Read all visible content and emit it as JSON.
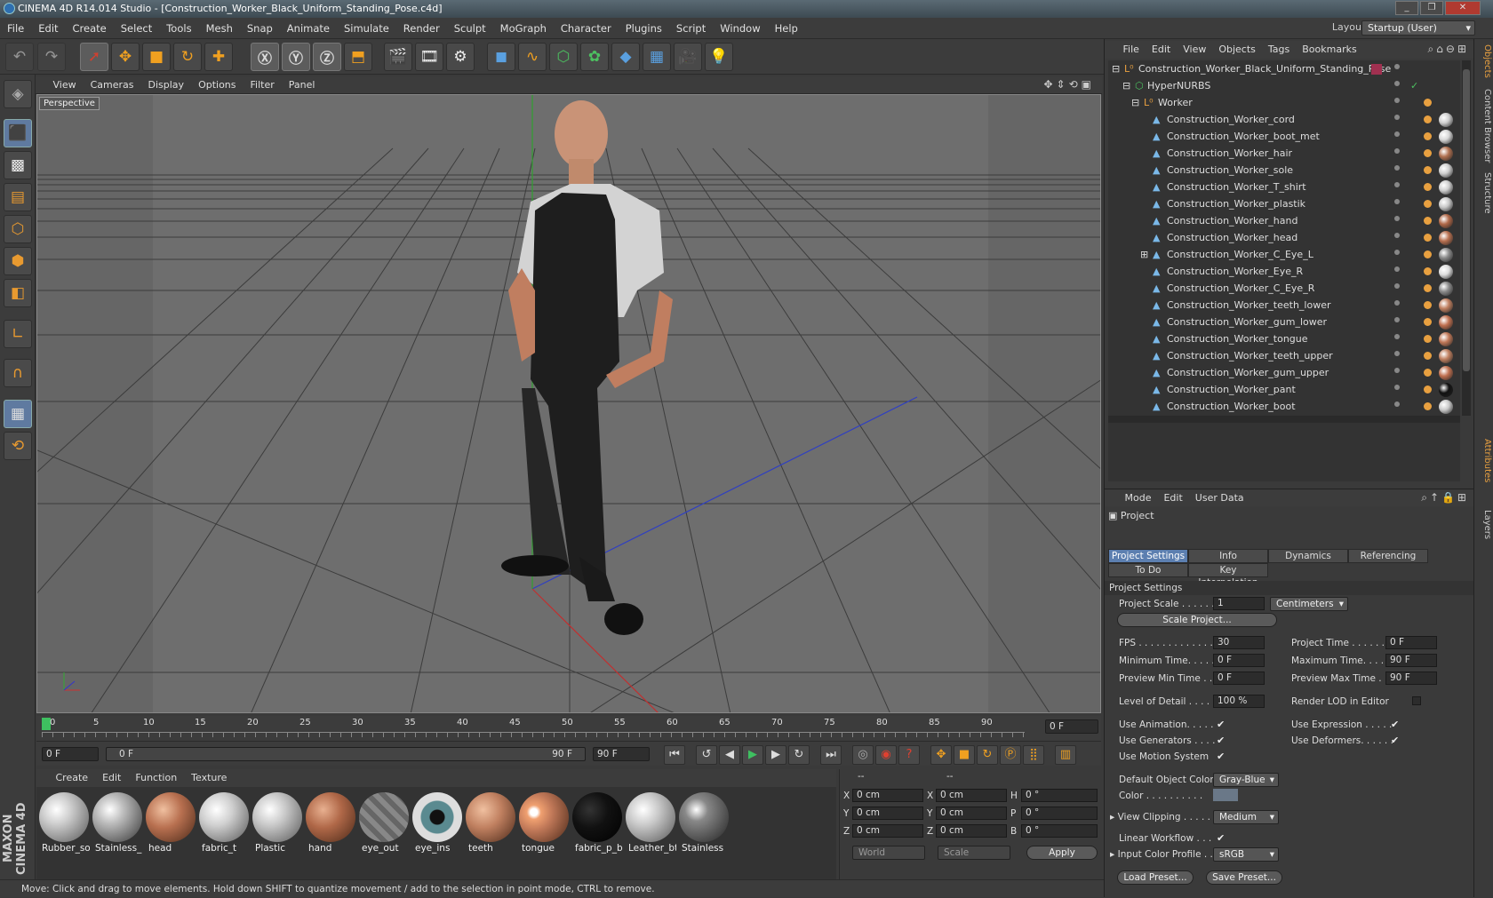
{
  "window": {
    "title": "CINEMA 4D R14.014 Studio - [Construction_Worker_Black_Uniform_Standing_Pose.c4d]",
    "layout_label": "Layout:",
    "layout_value": "Startup (User)"
  },
  "menu": [
    "File",
    "Edit",
    "Create",
    "Select",
    "Tools",
    "Mesh",
    "Snap",
    "Animate",
    "Simulate",
    "Render",
    "Sculpt",
    "MoGraph",
    "Character",
    "Plugins",
    "Script",
    "Window",
    "Help"
  ],
  "viewport": {
    "menu": [
      "View",
      "Cameras",
      "Display",
      "Options",
      "Filter",
      "Panel"
    ],
    "label": "Perspective"
  },
  "timeline": {
    "ticks": [
      "0",
      "5",
      "10",
      "15",
      "20",
      "25",
      "30",
      "35",
      "40",
      "45",
      "50",
      "55",
      "60",
      "65",
      "70",
      "75",
      "80",
      "85",
      "90"
    ],
    "current_frame": "0 F",
    "start_field": "0 F",
    "slider_left": "0 F",
    "slider_right": "90 F",
    "end_field": "90 F"
  },
  "materials": {
    "menu": [
      "Create",
      "Edit",
      "Function",
      "Texture"
    ],
    "items": [
      {
        "name": "Rubber_so",
        "color": "#d0d0d0"
      },
      {
        "name": "Stainless_",
        "color": "#bdbdbd"
      },
      {
        "name": "head",
        "color": "#b87050"
      },
      {
        "name": "fabric_t",
        "color": "#cfcfcf"
      },
      {
        "name": "Plastic",
        "color": "#c8c8c8"
      },
      {
        "name": "hand",
        "color": "#b06848"
      },
      {
        "name": "eye_out",
        "color": "#7a7a7a"
      },
      {
        "name": "eye_ins",
        "color": "#6a8a90"
      },
      {
        "name": "teeth",
        "color": "#c08060"
      },
      {
        "name": "tongue",
        "color": "#c07858"
      },
      {
        "name": "fabric_p_b",
        "color": "#111111"
      },
      {
        "name": "Leather_bt",
        "color": "#c8c8c8"
      },
      {
        "name": "Stainless",
        "color": "#555555"
      }
    ]
  },
  "coords": {
    "header1": "--",
    "header2": "--",
    "rows": [
      {
        "a": "X",
        "av": "0 cm",
        "b": "X",
        "bv": "0 cm",
        "c": "H",
        "cv": "0 °"
      },
      {
        "a": "Y",
        "av": "0 cm",
        "b": "Y",
        "bv": "0 cm",
        "c": "P",
        "cv": "0 °"
      },
      {
        "a": "Z",
        "av": "0 cm",
        "b": "Z",
        "bv": "0 cm",
        "c": "B",
        "cv": "0 °"
      }
    ],
    "world": "World",
    "scale": "Scale",
    "apply": "Apply"
  },
  "status": "Move: Click and drag to move elements. Hold down SHIFT to quantize movement / add to the selection in point mode, CTRL to remove.",
  "maxon": "MAXON CINEMA 4D",
  "objects": {
    "menu": [
      "File",
      "Edit",
      "View",
      "Objects",
      "Tags",
      "Bookmarks"
    ],
    "root": "Construction_Worker_Black_Uniform_Standing_Pose",
    "hypernurbs": "HyperNURBS",
    "worker": "Worker",
    "children": [
      {
        "name": "Construction_Worker_cord",
        "tag": "#cfcfcf"
      },
      {
        "name": "Construction_Worker_boot_met",
        "tag": "#d8d8d8"
      },
      {
        "name": "Construction_Worker_hair",
        "tag": "#b07050"
      },
      {
        "name": "Construction_Worker_sole",
        "tag": "#cfcfcf"
      },
      {
        "name": "Construction_Worker_T_shirt",
        "tag": "#d0d0d0"
      },
      {
        "name": "Construction_Worker_plastik",
        "tag": "#c8c8c8"
      },
      {
        "name": "Construction_Worker_hand",
        "tag": "#b06848"
      },
      {
        "name": "Construction_Worker_head",
        "tag": "#b87050"
      },
      {
        "name": "Construction_Worker_C_Eye_L",
        "tag": "#8a8a8a"
      },
      {
        "name": "Construction_Worker_Eye_R",
        "tag": "#ddd"
      },
      {
        "name": "Construction_Worker_C_Eye_R",
        "tag": "#8a8a8a"
      },
      {
        "name": "Construction_Worker_teeth_lower",
        "tag": "#c08060"
      },
      {
        "name": "Construction_Worker_gum_lower",
        "tag": "#c07050"
      },
      {
        "name": "Construction_Worker_tongue",
        "tag": "#c07858"
      },
      {
        "name": "Construction_Worker_teeth_upper",
        "tag": "#c08060"
      },
      {
        "name": "Construction_Worker_gum_upper",
        "tag": "#c07050"
      },
      {
        "name": "Construction_Worker_pant",
        "tag": "#111"
      },
      {
        "name": "Construction_Worker_boot",
        "tag": "#ccc"
      }
    ]
  },
  "attributes": {
    "menu": [
      "Mode",
      "Edit",
      "User Data"
    ],
    "title": "Project",
    "tabs_row1": [
      "Project Settings",
      "Info",
      "Dynamics",
      "Referencing"
    ],
    "tabs_row2": [
      "To Do",
      "Key Interpolation"
    ],
    "section": "Project Settings",
    "project_scale_label": "Project Scale . . . . . .",
    "project_scale_value": "1",
    "units": "Centimeters",
    "scale_project_btn": "Scale Project...",
    "fps_label": "FPS . . . . . . . . . . . . . . .",
    "fps_value": "30",
    "project_time_label": "Project Time . . . . . . .",
    "project_time_value": "0 F",
    "min_time_label": "Minimum Time. . . . .",
    "min_time_value": "0 F",
    "max_time_label": "Maximum Time. . . . .",
    "max_time_value": "90 F",
    "prev_min_label": "Preview Min Time . .",
    "prev_min_value": "0 F",
    "prev_max_label": "Preview Max Time . . .",
    "prev_max_value": "90 F",
    "lod_label": "Level of Detail . . . . .",
    "lod_value": "100 %",
    "render_lod_label": "Render LOD in Editor",
    "use_anim_label": "Use Animation. . . . .",
    "use_expr_label": "Use Expression . . . . .",
    "use_gen_label": "Use Generators . . . .",
    "use_def_label": "Use Deformers. . . . . .",
    "use_motion_label": "Use Motion System",
    "def_color_label": "Default Object Color",
    "def_color_value": "Gray-Blue",
    "color_label": "Color . . . . . . . . . .",
    "view_clip_label": "View Clipping . . . . .",
    "view_clip_value": "Medium",
    "linear_label": "Linear Workflow . . .",
    "input_profile_label": "Input Color Profile . .",
    "input_profile_value": "sRGB",
    "load_preset": "Load Preset...",
    "save_preset": "Save Preset..."
  },
  "side_tabs": [
    "Objects",
    "Content Browser",
    "Structure",
    "Attributes",
    "Layers"
  ]
}
